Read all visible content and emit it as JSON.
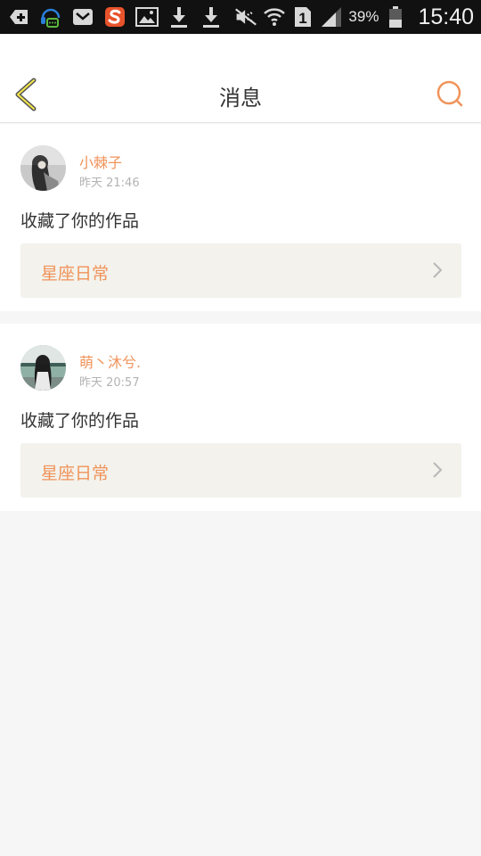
{
  "status_bar": {
    "icons": [
      "add-box-icon",
      "headset-message-icon",
      "envelope-icon",
      "sogou-icon",
      "image-icon",
      "download-icon",
      "download-icon",
      "mute-icon",
      "wifi-icon",
      "sim-1-icon",
      "signal-icon",
      "battery-icon"
    ],
    "sim_label": "1",
    "battery": "39%",
    "time": "15:40"
  },
  "header": {
    "title": "消息",
    "accent_color": "#f0935a"
  },
  "messages": [
    {
      "user": "小棘子",
      "time": "昨天 21:46",
      "action": "收藏了你的作品",
      "work": "星座日常"
    },
    {
      "user": "萌丶沐兮.",
      "time": "昨天 20:57",
      "action": "收藏了你的作品",
      "work": "星座日常"
    }
  ]
}
